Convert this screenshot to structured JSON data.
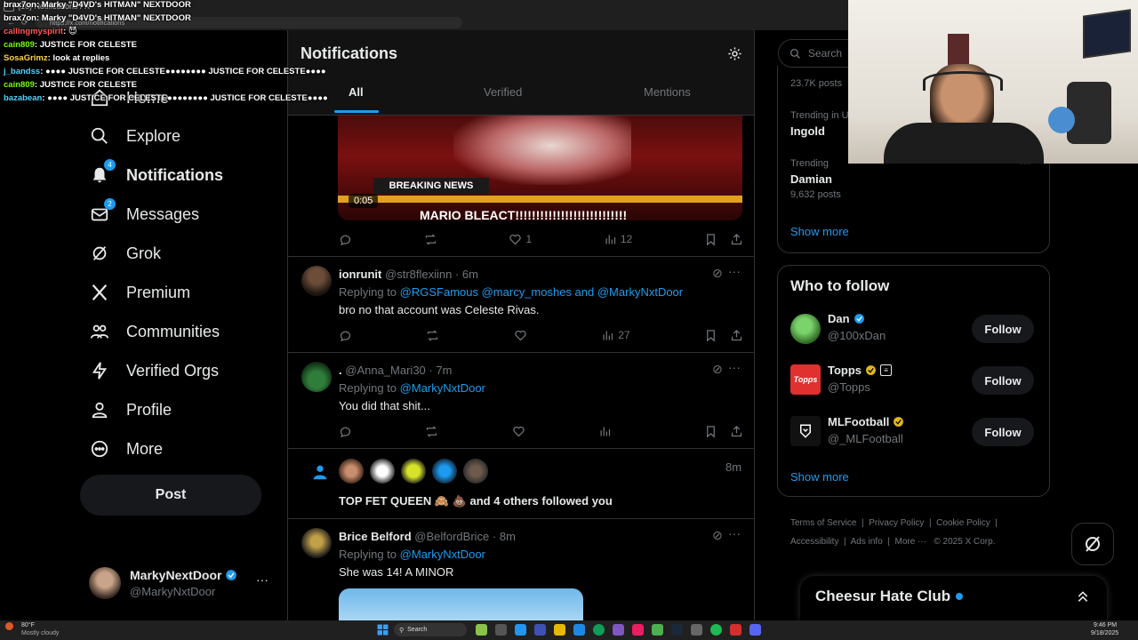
{
  "browser": {
    "tab_title": "(16) Notifications / X",
    "url": "https://x.com/notifications"
  },
  "chat": [
    {
      "user": "brax7on",
      "color": "#ffffff",
      "text": "Marky \"D4VD's HITMAN\" NEXTDOOR"
    },
    {
      "user": "brax7on",
      "color": "#ffffff",
      "text": "Marky \"D4VD's HITMAN\" NEXTDOOR"
    },
    {
      "user": "callingmyspirit",
      "color": "#ff5a5a",
      "text": "😈"
    },
    {
      "user": "cain809",
      "color": "#7CFC00",
      "text": "JUSTICE FOR CELESTE"
    },
    {
      "user": "SosaGrimz",
      "color": "#ffd54a",
      "text": "look at replies"
    },
    {
      "user": "j_bandss",
      "color": "#4dd2ff",
      "text": "●●●● JUSTICE FOR CELESTE●●●●●●●● JUSTICE FOR CELESTE●●●●"
    },
    {
      "user": "cain809",
      "color": "#7CFC00",
      "text": "JUSTICE FOR CELESTE"
    },
    {
      "user": "bazabean",
      "color": "#4dd2ff",
      "text": "●●●● JUSTICE FOR CELESTE●●●●●●●● JUSTICE FOR CELESTE●●●●"
    }
  ],
  "nav": {
    "home": "Home",
    "explore": "Explore",
    "notifications": "Notifications",
    "notifications_badge": "4",
    "messages": "Messages",
    "messages_badge": "2",
    "grok": "Grok",
    "premium": "Premium",
    "communities": "Communities",
    "verified_orgs": "Verified Orgs",
    "profile": "Profile",
    "more": "More",
    "post": "Post"
  },
  "account": {
    "name": "MarkyNextDoor",
    "handle": "@MarkyNxtDoor"
  },
  "header": {
    "title": "Notifications",
    "tabs": [
      "All",
      "Verified",
      "Mentions"
    ]
  },
  "video": {
    "banner": "BREAKING NEWS",
    "ticker": "MARIO BLEACT!!!!!!!!!!!!!!!!!!!!!!!!!!!",
    "timestamp": "0:05",
    "likes": "1",
    "views": "12"
  },
  "tweets": [
    {
      "name": "ionrunit",
      "handle": "@str8flexiinn",
      "time": "· 6m",
      "reply_prefix": "Replying to",
      "reply_to": "@RGSFamous @marcy_moshes and @MarkyNxtDoor",
      "text": "bro no that account was Celeste Rivas.",
      "views": "27"
    },
    {
      "name": ".",
      "handle": "@Anna_Mari30",
      "time": "· 7m",
      "reply_prefix": "Replying to",
      "reply_to": "@MarkyNxtDoor",
      "text": "You did that shit...",
      "views": ""
    }
  ],
  "follow_notification": {
    "time": "8m",
    "text": "TOP FET QUEEN 🙈 💩 and 4 others followed you"
  },
  "tweet3": {
    "name": "Brice Belford",
    "handle": "@BelfordBrice",
    "time": "· 8m",
    "reply_prefix": "Replying to",
    "reply_to": "@MarkyNxtDoor",
    "text": "She was 14! A MINOR"
  },
  "search": {
    "placeholder": "Search"
  },
  "trending": {
    "top_posts": "23.7K posts",
    "items": [
      {
        "context": "Trending in U",
        "name": "Ingold",
        "posts": ""
      },
      {
        "context": "Trending",
        "name": "Damian",
        "posts": "9,632 posts"
      }
    ],
    "show_more": "Show more"
  },
  "who_to_follow": {
    "title": "Who to follow",
    "users": [
      {
        "name": "Dan",
        "handle": "@100xDan",
        "button": "Follow"
      },
      {
        "name": "Topps",
        "handle": "@Topps",
        "button": "Follow"
      },
      {
        "name": "MLFootball",
        "handle": "@_MLFootball",
        "button": "Follow"
      }
    ],
    "show_more": "Show more"
  },
  "footer": {
    "links": [
      "Terms of Service",
      "Privacy Policy",
      "Cookie Policy",
      "Accessibility",
      "Ads info",
      "More ···"
    ],
    "copyright": "© 2025 X Corp."
  },
  "community_bar": {
    "name": "Cheesur Hate Club"
  },
  "taskbar": {
    "weather_temp": "80°F",
    "weather_desc": "Mostly cloudy",
    "search": "Search",
    "time": "9:46 PM",
    "date": "9/18/2025"
  },
  "colors": {
    "accent": "#1d9bf0",
    "verified_gold": "#e2b719",
    "background": "#000000"
  }
}
